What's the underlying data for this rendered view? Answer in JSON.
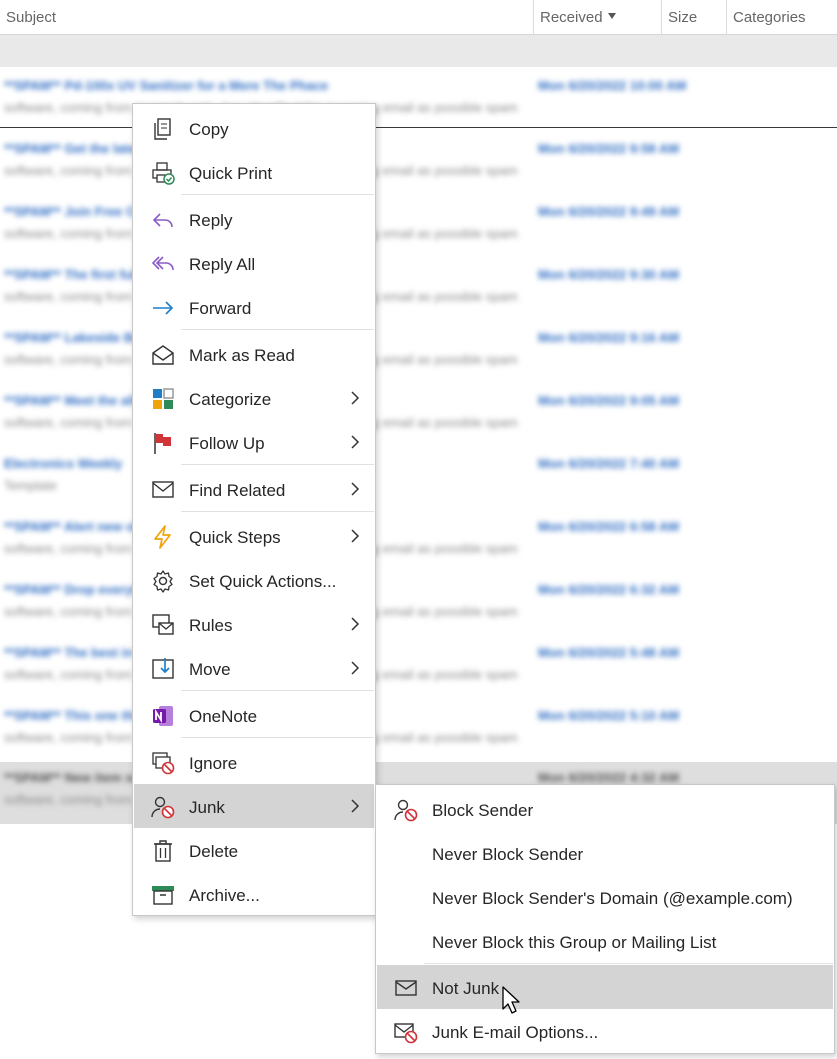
{
  "list_header": {
    "subject": "Subject",
    "received": "Received",
    "size": "Size",
    "categories": "Categories"
  },
  "messages": [
    {
      "subject": "**SPAM** Pd-100x UV Sanitizer for a Mere The Phace",
      "date": "Mon 6/20/2022 10:00 AM",
      "preview": "software, coming from 'example.net' - has identified this incoming email as possible spam"
    },
    {
      "subject": "**SPAM** Get the latest deals",
      "date": "Mon 6/20/2022 9:58 AM",
      "preview": "software, coming from 'example.net' - has identified this incoming email as possible spam"
    },
    {
      "subject": "**SPAM** Join Free Cloud Label Virtual Summit",
      "date": "Mon 6/20/2022 9:49 AM",
      "preview": "software, coming from 'example.net' - has identified this incoming email as possible spam"
    },
    {
      "subject": "**SPAM** The first fully wide arrives to inspect",
      "date": "Mon 6/20/2022 9:30 AM",
      "preview": "software, coming from 'example.net' - has identified this incoming email as possible spam"
    },
    {
      "subject": "**SPAM** Lakeside Best Sales Temperature",
      "date": "Mon 6/20/2022 9:16 AM",
      "preview": "software, coming from 'example.net' - has identified this incoming email as possible spam"
    },
    {
      "subject": "**SPAM** Meet the all new Smartwatch",
      "date": "Mon 6/20/2022 9:05 AM",
      "preview": "software, coming from 'example.net' - has identified this incoming email as possible spam"
    },
    {
      "subject": "Electronics Weekly",
      "date": "Mon 6/20/2022 7:40 AM",
      "preview": "Template"
    },
    {
      "subject": "**SPAM** Alert new offer available",
      "date": "Mon 6/20/2022 6:58 AM",
      "preview": "software, coming from 'example.net' - has identified this incoming email as possible spam"
    },
    {
      "subject": "**SPAM** Drop everything for this",
      "date": "Mon 6/20/2022 6:32 AM",
      "preview": "software, coming from 'example.net' - has identified this incoming email as possible spam"
    },
    {
      "subject": "**SPAM** The best in home monitoring mont",
      "date": "Mon 6/20/2022 5:48 AM",
      "preview": "software, coming from 'example.net' - has identified this incoming email as possible spam"
    },
    {
      "subject": "**SPAM** This one thing driving drivey",
      "date": "Mon 6/20/2022 5:10 AM",
      "preview": "software, coming from 'example.net' - has identified this incoming email as possible spam"
    },
    {
      "subject": "**SPAM** New item selected monitoring data by the page",
      "date": "Mon 6/20/2022 4:32 AM",
      "preview": "software, coming from 'example.net' - has identified this incoming email as possible spam"
    }
  ],
  "context_menu": {
    "copy": "Copy",
    "quick_print": "Quick Print",
    "reply": "Reply",
    "reply_all": "Reply All",
    "forward": "Forward",
    "mark_as_read": "Mark as Read",
    "categorize": "Categorize",
    "follow_up": "Follow Up",
    "find_related": "Find Related",
    "quick_steps": "Quick Steps",
    "set_quick_actions": "Set Quick Actions...",
    "rules": "Rules",
    "move": "Move",
    "onenote": "OneNote",
    "ignore": "Ignore",
    "junk": "Junk",
    "delete": "Delete",
    "archive": "Archive..."
  },
  "junk_submenu": {
    "block_sender": "Block Sender",
    "never_block_sender": "Never Block Sender",
    "never_block_domain": "Never Block Sender's Domain (@example.com)",
    "never_block_group": "Never Block this Group or Mailing List",
    "not_junk": "Not Junk",
    "junk_options": "Junk E-mail Options..."
  },
  "colors": {
    "hover": "#d4d4d4",
    "accent_blue": "#2f6dc4",
    "onenote_purple": "#7719aa",
    "block_red": "#d13438",
    "lightning_orange": "#f0a30a",
    "archive_green": "#2e8b57"
  }
}
